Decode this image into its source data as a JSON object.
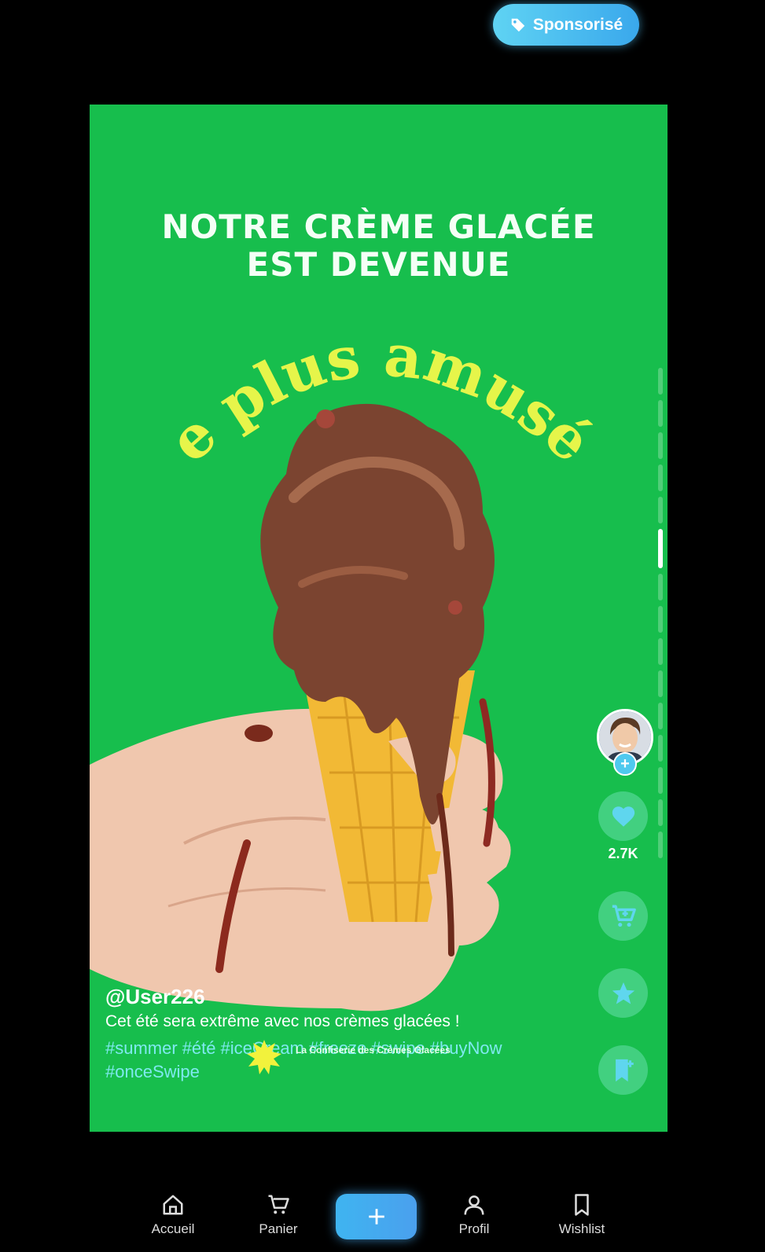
{
  "sponsored": {
    "label": "Sponsorisé",
    "icon": "tag-icon"
  },
  "ad": {
    "headline_line1": "NOTRE CRÈME GLACÉE",
    "headline_line2": "EST DEVENUE",
    "arc_text": "e plus amusé",
    "brand_overlay": "La Confiserie des Crèmes Glacées",
    "colors": {
      "background": "#17be4d",
      "arc_text": "#e6f54a"
    }
  },
  "post": {
    "username": "@User226",
    "description": "Cet été sera extrême avec nos crèmes glacées !",
    "hashtags": [
      "#summer",
      "#été",
      "#iceCream",
      "#freeze",
      "#swipe",
      "#buyNow",
      "#onceSwipe"
    ]
  },
  "actions": {
    "like_count": "2.7K",
    "buttons": [
      "heart-icon",
      "cart-add-icon",
      "star-icon",
      "bookmark-add-icon"
    ]
  },
  "progress": {
    "segments": 15,
    "active_index": 5
  },
  "nav": {
    "home": "Accueil",
    "cart": "Panier",
    "profile": "Profil",
    "wishlist": "Wishlist"
  }
}
